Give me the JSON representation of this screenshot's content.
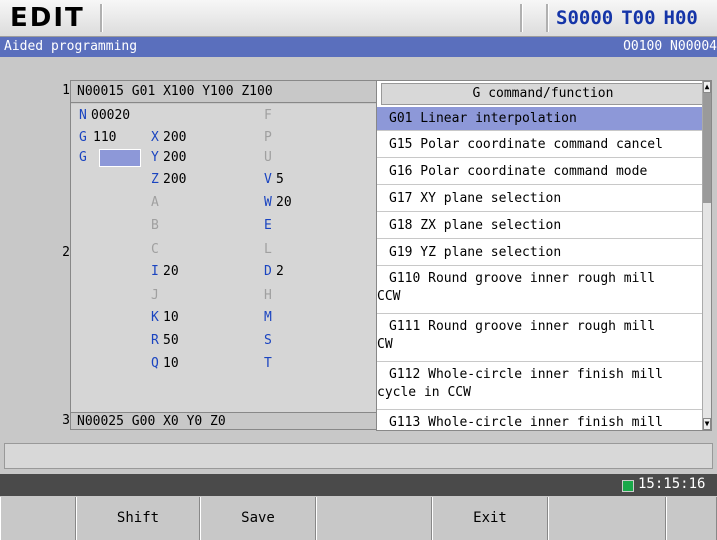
{
  "header": {
    "mode": "EDIT",
    "s_value": "S0000",
    "t_value": "T00",
    "h_value": "H00"
  },
  "titlebar": {
    "title": "Aided programming",
    "program_info": "O0100 N00004"
  },
  "line_numbers": [
    "1",
    "2",
    "3"
  ],
  "editor": {
    "line1": "N00015 G01 X100 Y100 Z100",
    "line3": "N00025 G00 X0 Y0 Z0"
  },
  "form": {
    "N_label": "N",
    "N_value": "00020",
    "G_label": "G",
    "G_value": "110",
    "G2_label": "G",
    "X_label": "X",
    "X_value": "200",
    "Y_label": "Y",
    "Y_value": "200",
    "Z_label": "Z",
    "Z_value": "200",
    "A_label": "A",
    "B_label": "B",
    "C_label": "C",
    "I_label": "I",
    "I_value": "20",
    "J_label": "J",
    "K_label": "K",
    "K_value": "10",
    "R_label": "R",
    "R_value": "50",
    "Q_label": "Q",
    "Q_value": "10",
    "F_label": "F",
    "P_label": "P",
    "U_label": "U",
    "V_label": "V",
    "V_value": "5",
    "W_label": "W",
    "W_value": "20",
    "E_label": "E",
    "L_label": "L",
    "D_label": "D",
    "D_value": "2",
    "H_label": "H",
    "M_label": "M",
    "S_label": "S",
    "T_label": "T"
  },
  "glist": {
    "header": "G command/function",
    "items": [
      "G01 Linear interpolation",
      "G15 Polar coordinate command cancel",
      "G16 Polar coordinate command mode",
      "G17 XY plane selection",
      "G18 ZX plane selection",
      "G19 YZ plane selection",
      "G110 Round groove inner rough mill",
      "CCW",
      "G111 Round groove inner rough mill",
      "CW",
      "G112 Whole-circle inner finish mill",
      "cycle in CCW",
      "G113 Whole-circle inner finish mill"
    ]
  },
  "status": {
    "time": "15:15:16"
  },
  "softkeys": [
    "",
    "Shift",
    "Save",
    "",
    "Exit",
    "",
    ""
  ]
}
